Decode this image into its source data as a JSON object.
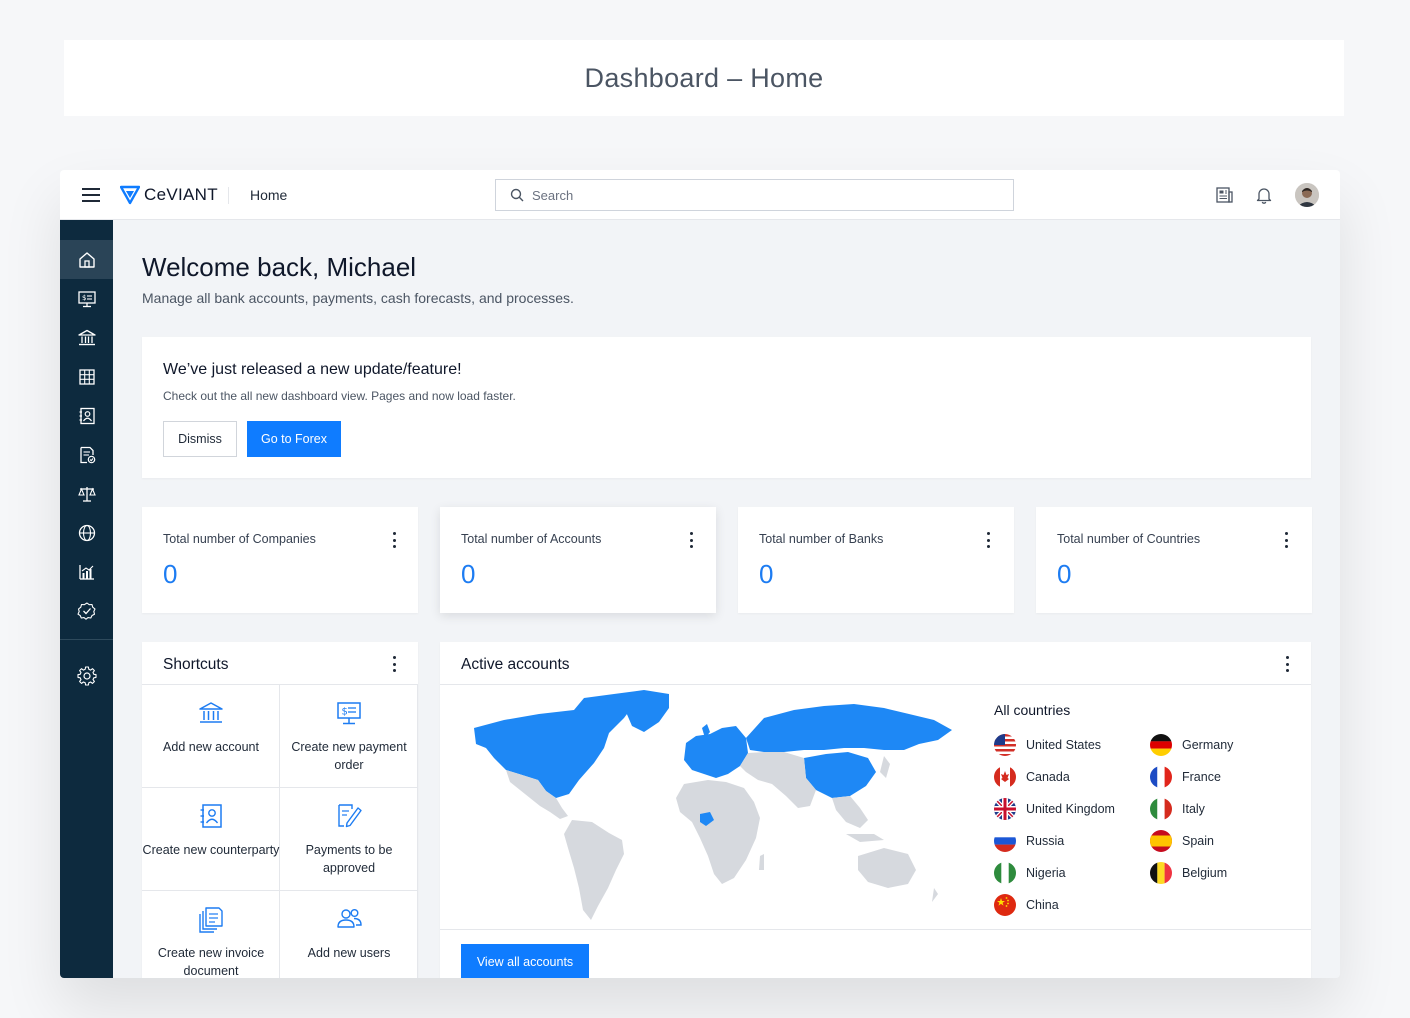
{
  "page_title": "Dashboard – Home",
  "app": {
    "brand": "CeVIANT",
    "breadcrumb": "Home",
    "search_placeholder": "Search"
  },
  "sidebar": {
    "items": [
      {
        "icon": "home-icon",
        "active": true
      },
      {
        "icon": "payment-terminal-icon"
      },
      {
        "icon": "bank-icon"
      },
      {
        "icon": "grid-table-icon"
      },
      {
        "icon": "contact-book-icon"
      },
      {
        "icon": "document-check-icon"
      },
      {
        "icon": "scales-icon"
      },
      {
        "icon": "globe-icon"
      },
      {
        "icon": "bar-chart-icon"
      },
      {
        "icon": "badge-check-icon"
      }
    ],
    "settings_icon": "gear-icon"
  },
  "welcome": {
    "title": "Welcome back, Michael",
    "subtitle": "Manage all bank accounts, payments, cash forecasts, and processes."
  },
  "update": {
    "title": "We’ve just released a new update/feature!",
    "body": "Check out the all new dashboard view. Pages and now load faster.",
    "dismiss_label": "Dismiss",
    "primary_label": "Go to Forex"
  },
  "stats": [
    {
      "label": "Total number of Companies",
      "value": "0"
    },
    {
      "label": "Total number of Accounts",
      "value": "0"
    },
    {
      "label": "Total number of Banks",
      "value": "0"
    },
    {
      "label": "Total number of Countries",
      "value": "0"
    }
  ],
  "shortcuts": {
    "title": "Shortcuts",
    "items": [
      {
        "label": "Add new account",
        "icon": "bank-icon"
      },
      {
        "label": "Create new payment order",
        "icon": "payment-terminal-icon"
      },
      {
        "label": "Create new counterparty",
        "icon": "contact-book-icon"
      },
      {
        "label": "Payments to be approved",
        "icon": "signature-pen-icon"
      },
      {
        "label": "Create new invoice document",
        "icon": "invoice-stack-icon"
      },
      {
        "label": "Add new users",
        "icon": "users-icon"
      }
    ]
  },
  "active_accounts": {
    "title": "Active accounts",
    "countries_heading": "All countries",
    "countries": [
      {
        "name": "United States",
        "flag": "us-flag-icon"
      },
      {
        "name": "Canada",
        "flag": "ca-flag-icon"
      },
      {
        "name": "United Kingdom",
        "flag": "gb-flag-icon"
      },
      {
        "name": "Russia",
        "flag": "ru-flag-icon"
      },
      {
        "name": "Nigeria",
        "flag": "ng-flag-icon"
      },
      {
        "name": "China",
        "flag": "cn-flag-icon"
      },
      {
        "name": "Germany",
        "flag": "de-flag-icon"
      },
      {
        "name": "France",
        "flag": "fr-flag-icon"
      },
      {
        "name": "Italy",
        "flag": "it-flag-icon"
      },
      {
        "name": "Spain",
        "flag": "es-flag-icon"
      },
      {
        "name": "Belgium",
        "flag": "be-flag-icon"
      }
    ],
    "view_all_label": "View all accounts"
  },
  "colors": {
    "accent": "#0f7cff",
    "sidebar_bg": "#0d2a3e",
    "map_highlight": "#1e88f5",
    "map_land": "#d6d9de"
  }
}
